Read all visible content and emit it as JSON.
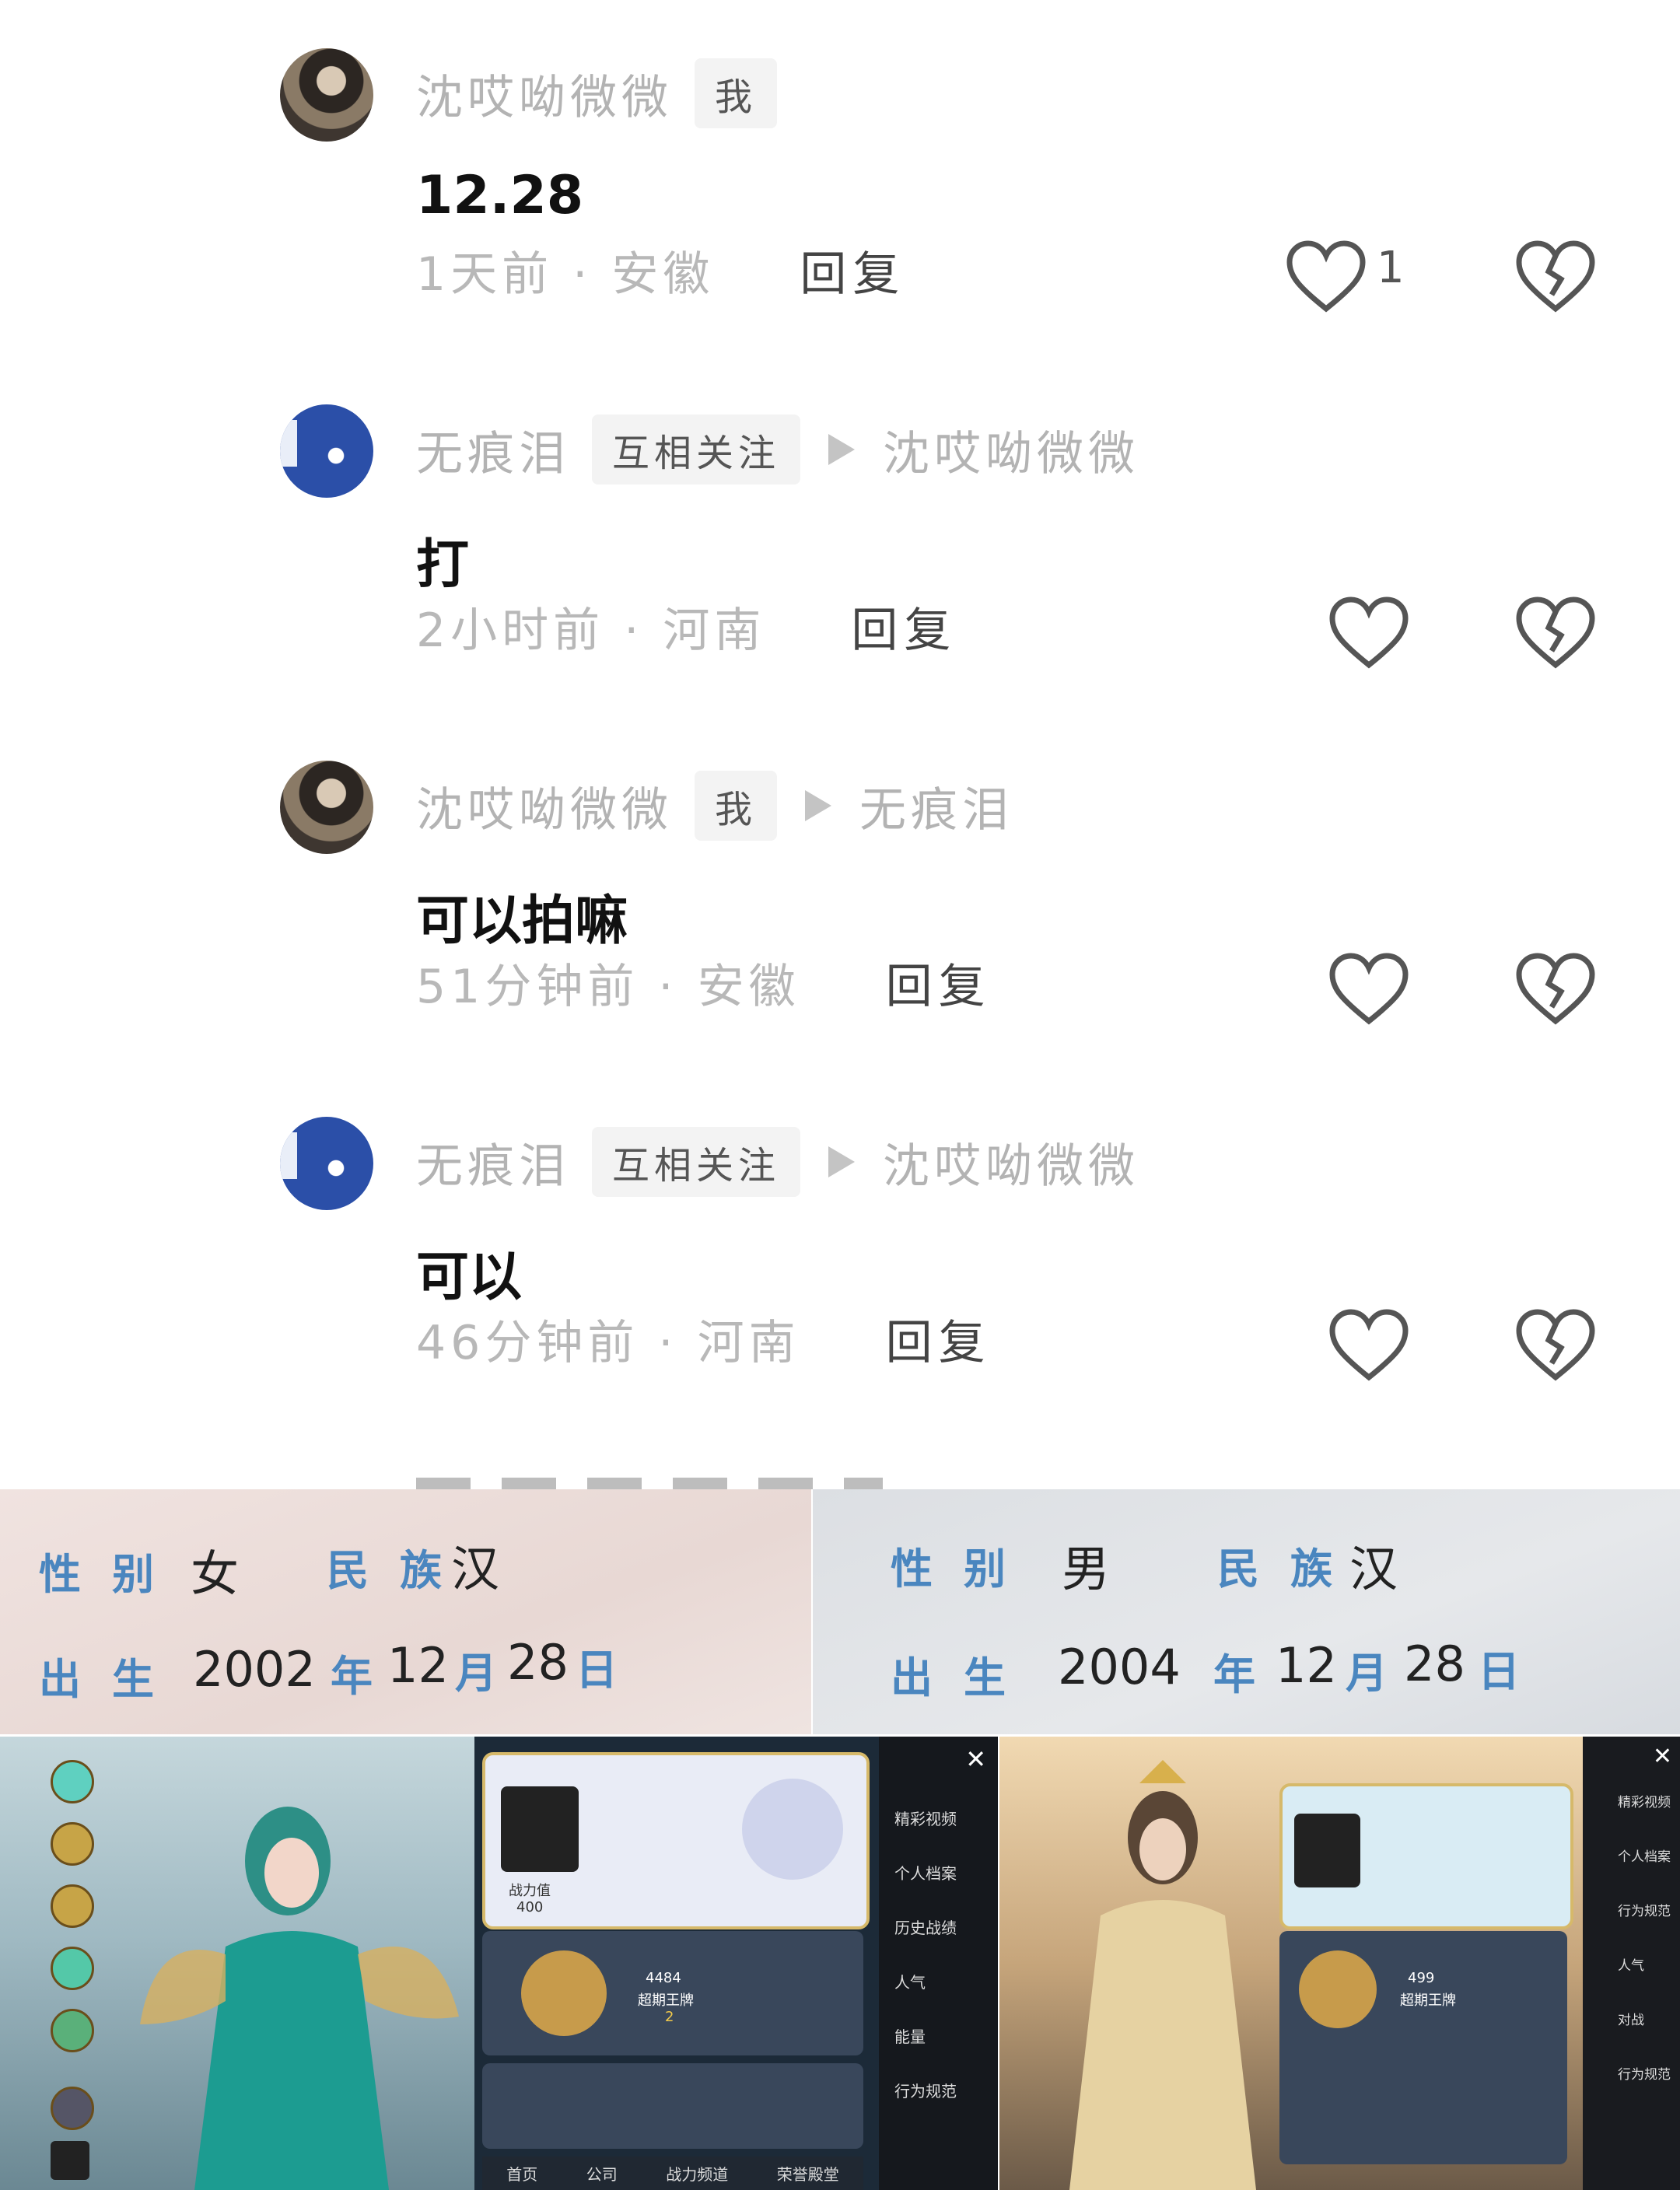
{
  "comments": [
    {
      "author": "沈哎呦微微",
      "tag": "我",
      "reply_to": "",
      "content": "12.28",
      "time_location": "1天前 · 安徽",
      "reply_label": "回复",
      "likes": "1"
    },
    {
      "author": "无痕泪",
      "tag": "互相关注",
      "reply_to": "沈哎呦微微",
      "content": "打",
      "time_location": "2小时前 · 河南",
      "reply_label": "回复",
      "likes": ""
    },
    {
      "author": "沈哎呦微微",
      "tag": "我",
      "reply_to": "无痕泪",
      "content": "可以拍嘛",
      "time_location": "51分钟前 · 安徽",
      "reply_label": "回复",
      "likes": ""
    },
    {
      "author": "无痕泪",
      "tag": "互相关注",
      "reply_to": "沈哎呦微微",
      "content": "可以",
      "time_location": "46分钟前 · 河南",
      "reply_label": "回复",
      "likes": ""
    }
  ],
  "id_cards": [
    {
      "gender_label": "性别",
      "gender": "女",
      "ethnicity_label": "民族",
      "ethnicity": "汉",
      "birth_label": "出生",
      "year": "2002",
      "year_label": "年",
      "month": "12",
      "month_label": "月",
      "day": "28",
      "day_label": "日"
    },
    {
      "gender_label": "性别",
      "gender": "男",
      "ethnicity_label": "民族",
      "ethnicity": "汉",
      "birth_label": "出生",
      "year": "2004",
      "year_label": "年",
      "month": "12",
      "month_label": "月",
      "day": "28",
      "day_label": "日"
    }
  ],
  "game_left": {
    "power_label": "战力值",
    "power_value": "400",
    "rank_value": "4484",
    "rank_name": "超期王牌",
    "stars": "2",
    "bottom_tabs": [
      "首页",
      "公司",
      "战力频道",
      "荣誉殿堂"
    ],
    "menu": [
      "精彩视频",
      "个人档案",
      "历史战绩",
      "人气",
      "能量",
      "行为规范"
    ]
  },
  "game_right": {
    "rank_value": "499",
    "rank_name": "超期王牌",
    "menu": [
      "精彩视频",
      "个人档案",
      "行为规范",
      "人气",
      "对战",
      "行为规范"
    ]
  },
  "icons": [
    "heart-icon",
    "broken-heart-icon",
    "play-arrow-icon",
    "home-icon",
    "close-icon"
  ]
}
